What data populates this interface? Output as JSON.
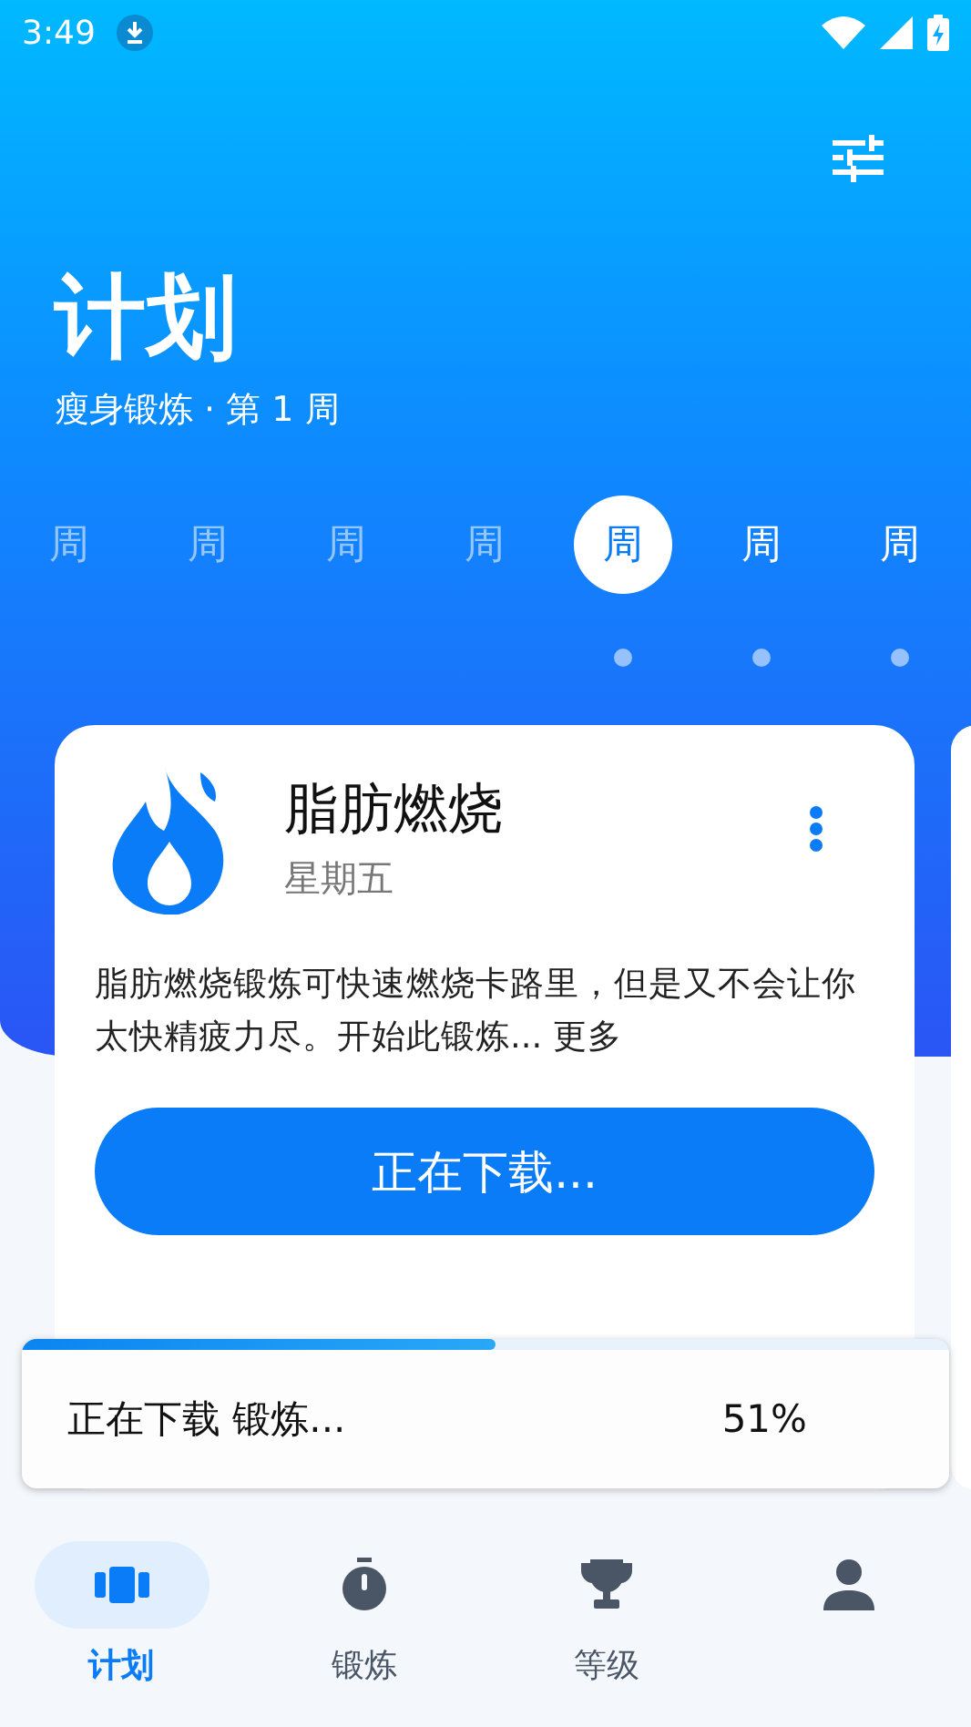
{
  "status_bar": {
    "time": "3:49"
  },
  "header": {
    "title": "计划",
    "subtitle": "瘦身锻炼 · 第 1 周"
  },
  "week_days": [
    {
      "label": "周",
      "selected": false,
      "past": true,
      "dot": false
    },
    {
      "label": "周",
      "selected": false,
      "past": true,
      "dot": false
    },
    {
      "label": "周",
      "selected": false,
      "past": true,
      "dot": false
    },
    {
      "label": "周",
      "selected": false,
      "past": true,
      "dot": false
    },
    {
      "label": "周",
      "selected": true,
      "past": false,
      "dot": true
    },
    {
      "label": "周",
      "selected": false,
      "past": false,
      "dot": true
    },
    {
      "label": "周",
      "selected": false,
      "past": false,
      "dot": true
    }
  ],
  "workout_card": {
    "title": "脂肪燃烧",
    "day": "星期五",
    "description": "脂肪燃烧锻炼可快速燃烧卡路里，但是又不会让你太快精疲力尽。开始此锻炼...",
    "more_link": "更多",
    "button": "正在下载..."
  },
  "download_banner": {
    "text": "正在下载 锻炼...",
    "percent": "51%",
    "level": 0.51
  },
  "bottom_nav": [
    {
      "kind": "plan",
      "label": "计划",
      "selected": true
    },
    {
      "kind": "workout",
      "label": "锻炼",
      "selected": false
    },
    {
      "kind": "rank",
      "label": "等级",
      "selected": false
    },
    {
      "kind": "profile",
      "selected": false
    }
  ]
}
